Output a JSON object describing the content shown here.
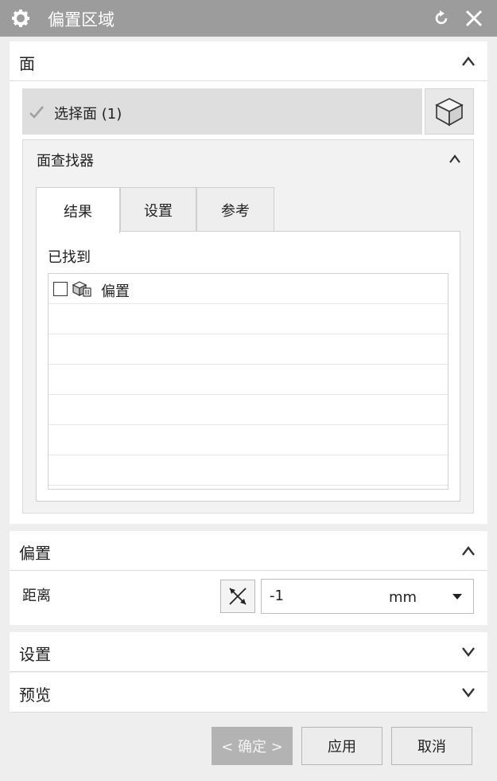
{
  "window": {
    "title": "偏置区域",
    "gear_icon": "gear-icon",
    "reset_icon": "reset-icon",
    "close_icon": "close-icon"
  },
  "face_section": {
    "title": "面",
    "select_label": "选择面 (1)",
    "finder": {
      "title": "面查找器",
      "tabs": [
        "结果",
        "设置",
        "参考"
      ],
      "active_tab": "结果",
      "found_label": "已找到",
      "items": [
        {
          "label": "偏置",
          "checked": false
        }
      ],
      "empty_rows": 6
    }
  },
  "offset_section": {
    "title": "偏置",
    "distance_label": "距离",
    "distance_value": "-1",
    "unit": "mm"
  },
  "settings_section": {
    "title": "设置"
  },
  "preview_section": {
    "title": "预览"
  },
  "footer": {
    "ok_label": "< 确定 >",
    "apply_label": "应用",
    "cancel_label": "取消"
  },
  "colors": {
    "titlebar": "#9c9c9c",
    "ok_button_disabled": "#b3b3b3"
  }
}
